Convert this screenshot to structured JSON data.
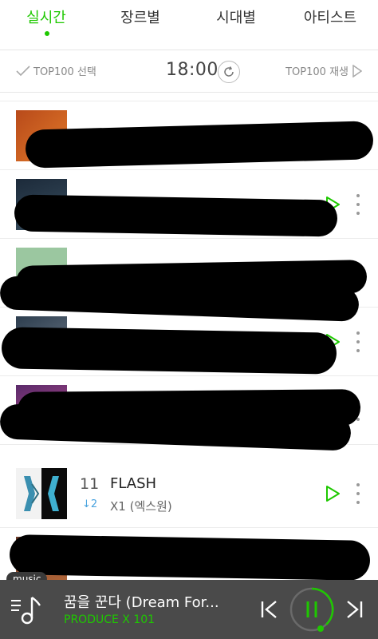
{
  "tabs": [
    {
      "label": "실시간",
      "active": true
    },
    {
      "label": "장르별",
      "active": false
    },
    {
      "label": "시대별",
      "active": false
    },
    {
      "label": "아티스트",
      "active": false
    }
  ],
  "controls": {
    "select_all_label": "TOP100 선택",
    "time": "18:00",
    "play_all_label": "TOP100 재생"
  },
  "chart_items": [
    {
      "rank": "11",
      "title": "FLASH",
      "change": "↓2",
      "artist": "X1 (엑스원)"
    }
  ],
  "player": {
    "badge": "music",
    "now_playing_title": "꿈을 꾼다 (Dream For...",
    "now_playing_artist": "PRODUCE X 101"
  },
  "colors": {
    "accent": "#1ec800",
    "rank_change_down": "#4aa3df",
    "player_bg": "#4a4a4a"
  },
  "icons": [
    "check-icon",
    "refresh-icon",
    "play-triangle-icon",
    "more-vert-icon",
    "queue-icon",
    "prev-icon",
    "pause-icon",
    "next-icon"
  ]
}
